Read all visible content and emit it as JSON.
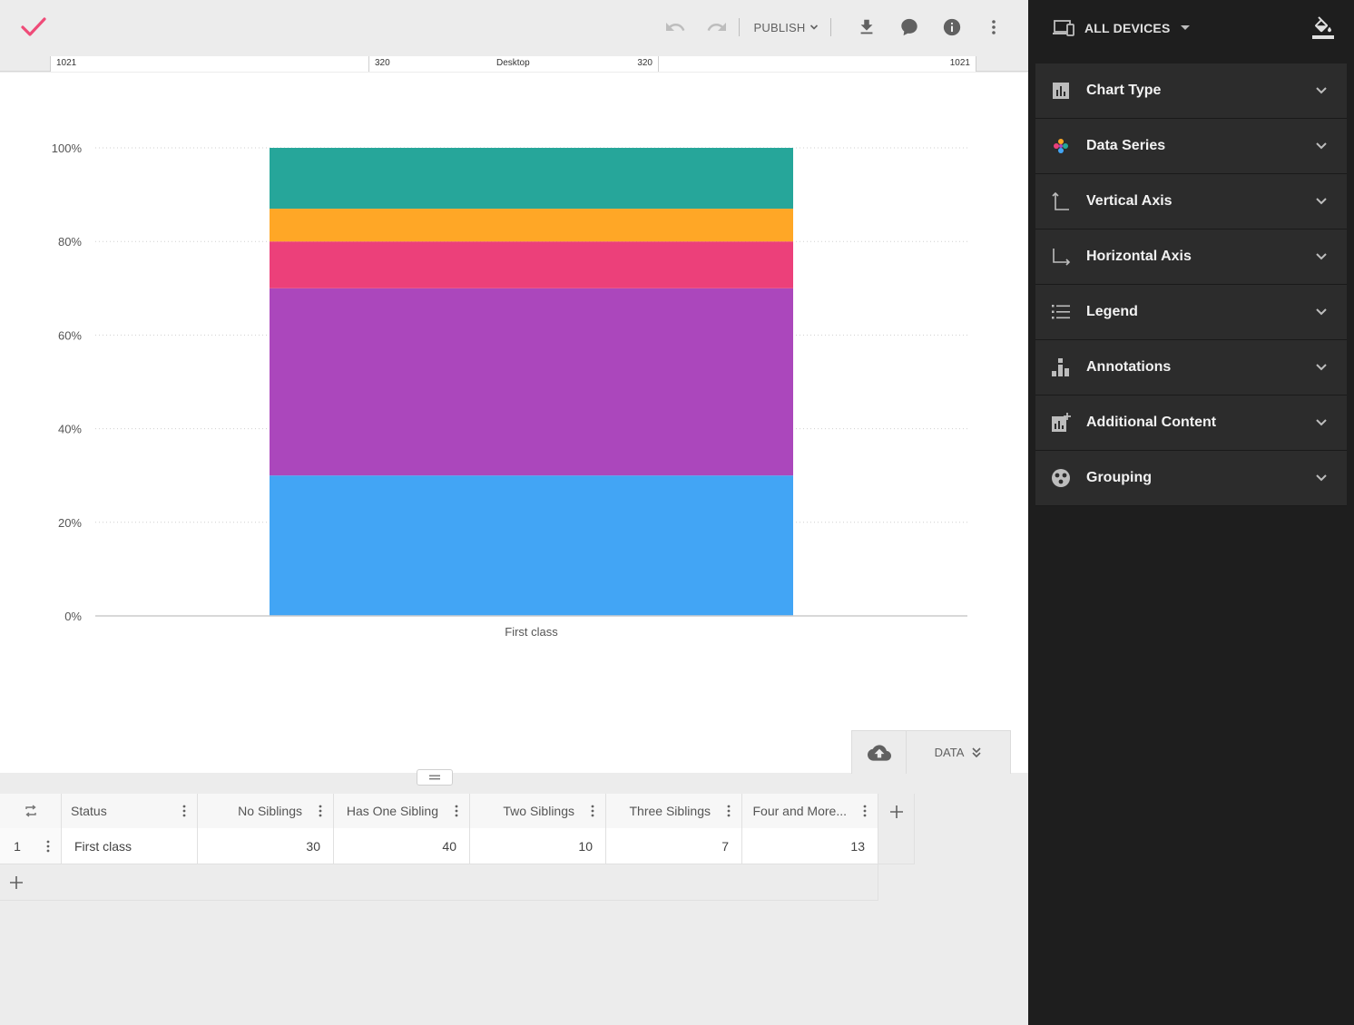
{
  "toolbar": {
    "publish_label": "PUBLISH",
    "icons": [
      "check-icon",
      "undo-icon",
      "redo-icon",
      "download-icon",
      "comment-icon",
      "info-icon",
      "more-vert-icon"
    ]
  },
  "ruler": {
    "left_outer": "1021",
    "left_inner": "320",
    "center": "Desktop",
    "right_inner": "320",
    "right_outer": "1021"
  },
  "data_bar": {
    "data_label": "DATA"
  },
  "colors": {
    "accent": "#ef4b78",
    "sidebar_bg": "#1e1e1e",
    "panel_bg": "#2c2c2c"
  },
  "chart_data": {
    "type": "bar",
    "stacked": "percent",
    "categories": [
      "First class"
    ],
    "series": [
      {
        "name": "No Siblings",
        "values": [
          30
        ],
        "color": "#42a5f5"
      },
      {
        "name": "Has One Sibling",
        "values": [
          40
        ],
        "color": "#ab47bc"
      },
      {
        "name": "Two Siblings",
        "values": [
          10
        ],
        "color": "#ec407a"
      },
      {
        "name": "Three Siblings",
        "values": [
          7
        ],
        "color": "#ffa726"
      },
      {
        "name": "Four and More Siblings",
        "values": [
          13
        ],
        "color": "#26a69a"
      }
    ],
    "yticks": [
      "0%",
      "20%",
      "40%",
      "60%",
      "80%",
      "100%"
    ],
    "ylim": [
      0,
      100
    ],
    "grid": true,
    "legend": "none"
  },
  "table": {
    "headers": [
      "Status",
      "No Siblings",
      "Has One Sibling",
      "Two Siblings",
      "Three Siblings",
      "Four and More..."
    ],
    "rows": [
      {
        "num": "1",
        "cells": [
          "First class",
          "30",
          "40",
          "10",
          "7",
          "13"
        ]
      }
    ]
  },
  "sidebar": {
    "device_label": "ALL DEVICES",
    "panels": [
      {
        "title": "Chart Type",
        "icon": "bar-chart-icon"
      },
      {
        "title": "Data Series",
        "icon": "palette-dots-icon"
      },
      {
        "title": "Vertical Axis",
        "icon": "vertical-axis-icon"
      },
      {
        "title": "Horizontal Axis",
        "icon": "horizontal-axis-icon"
      },
      {
        "title": "Legend",
        "icon": "list-icon"
      },
      {
        "title": "Annotations",
        "icon": "annotations-icon"
      },
      {
        "title": "Additional Content",
        "icon": "add-chart-icon"
      },
      {
        "title": "Grouping",
        "icon": "grouping-icon"
      }
    ]
  }
}
